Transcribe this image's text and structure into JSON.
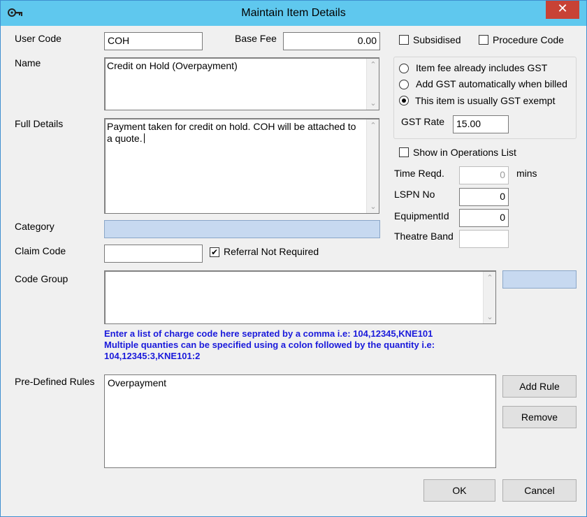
{
  "window": {
    "title": "Maintain Item Details",
    "close_glyph": "✕",
    "app_icon": "key-icon"
  },
  "user_code": {
    "label": "User Code",
    "value": "COH"
  },
  "base_fee": {
    "label": "Base Fee",
    "value": "0.00"
  },
  "subsidised": {
    "label": "Subsidised",
    "checked": false
  },
  "procedure_code": {
    "label": "Procedure Code",
    "checked": false
  },
  "name": {
    "label": "Name",
    "value": "Credit on Hold (Overpayment)"
  },
  "full_details": {
    "label": "Full Details",
    "value": "Payment taken for credit on hold. COH will be attached to a quote."
  },
  "gst": {
    "options": [
      {
        "label": "Item fee already includes GST",
        "selected": false
      },
      {
        "label": "Add GST automatically when billed",
        "selected": false
      },
      {
        "label": "This item is usually GST exempt",
        "selected": true
      }
    ],
    "rate_label": "GST Rate",
    "rate_value": "15.00"
  },
  "show_in_operations": {
    "label": "Show in Operations List",
    "checked": false
  },
  "time_reqd": {
    "label": "Time Reqd.",
    "value": "0",
    "unit": "mins"
  },
  "lspn_no": {
    "label": "LSPN No",
    "value": "0"
  },
  "equipment_id": {
    "label": "EquipmentId",
    "value": "0"
  },
  "theatre_band": {
    "label": "Theatre Band",
    "value": ""
  },
  "category": {
    "label": "Category",
    "value": ""
  },
  "claim_code": {
    "label": "Claim Code",
    "value": ""
  },
  "referral_not_required": {
    "label": "Referral Not Required",
    "checked": true,
    "check_glyph": "✔"
  },
  "code_group": {
    "label": "Code Group",
    "value": "",
    "side_value": "",
    "hint_line1": "Enter a list of charge code here seprated by a comma i.e: 104,12345,KNE101",
    "hint_line2": "Multiple quanties can be specified using a colon followed by the quantity i.e: 104,12345:3,KNE101:2"
  },
  "predefined_rules": {
    "label": "Pre-Defined Rules",
    "items": [
      "Overpayment"
    ]
  },
  "buttons": {
    "add_rule": "Add Rule",
    "remove": "Remove",
    "ok": "OK",
    "cancel": "Cancel"
  },
  "scroll": {
    "up": "⌃",
    "down": "⌄"
  }
}
